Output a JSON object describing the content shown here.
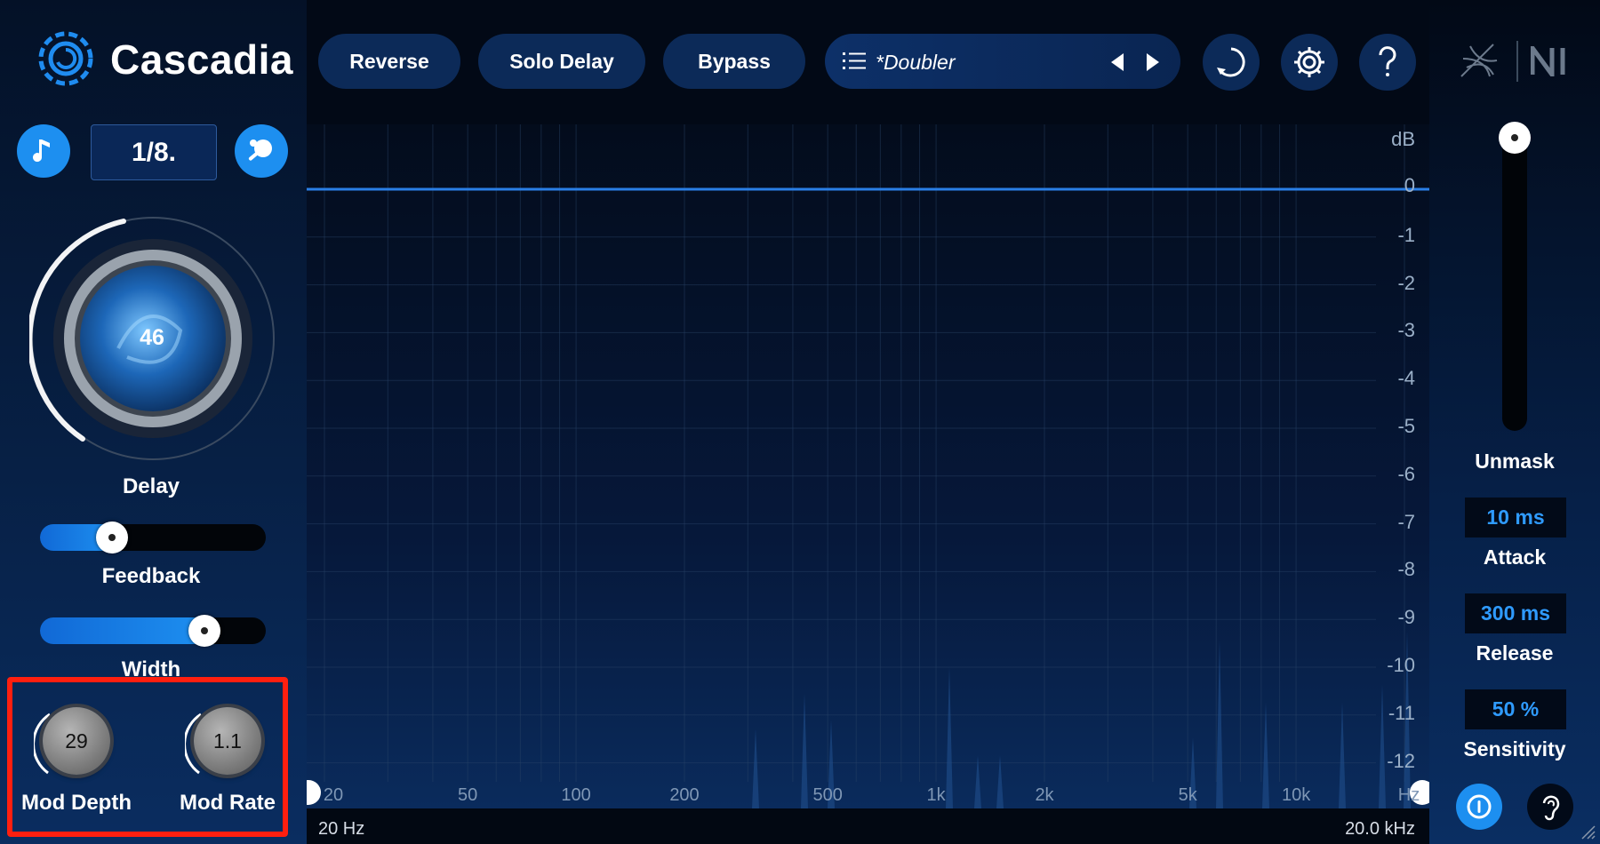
{
  "app": {
    "title": "Cascadia"
  },
  "left": {
    "sync_value": "1/8.",
    "delay": {
      "value": "46",
      "label": "Delay"
    },
    "feedback": {
      "label": "Feedback",
      "level": 0.32
    },
    "width": {
      "label": "Width",
      "level": 0.73
    },
    "mod_depth": {
      "value": "29",
      "label": "Mod Depth"
    },
    "mod_rate": {
      "value": "1.1",
      "label": "Mod Rate"
    }
  },
  "toolbar": {
    "reverse_label": "Reverse",
    "solo_delay_label": "Solo Delay",
    "bypass_label": "Bypass",
    "preset_name": "*Doubler"
  },
  "spectrum": {
    "db_unit": "dB",
    "db_ticks": [
      "0",
      "-1",
      "-2",
      "-3",
      "-4",
      "-5",
      "-6",
      "-7",
      "-8",
      "-9",
      "-10",
      "-11",
      "-12"
    ],
    "hz_ticks": [
      "20",
      "50",
      "100",
      "200",
      "500",
      "1k",
      "2k",
      "5k",
      "10k",
      "Hz"
    ],
    "accent": "#2a7fe6"
  },
  "status": {
    "min_freq": "20 Hz",
    "max_freq": "20.0 kHz"
  },
  "right": {
    "unmask_label": "Unmask",
    "attack": {
      "value": "10 ms",
      "label": "Attack"
    },
    "release": {
      "value": "300 ms",
      "label": "Release"
    },
    "sensitivity": {
      "value": "50 %",
      "label": "Sensitivity"
    }
  },
  "colors": {
    "accent": "#1d8ff0",
    "highlight": "#ff1f0f",
    "value_text": "#2f9bff"
  }
}
